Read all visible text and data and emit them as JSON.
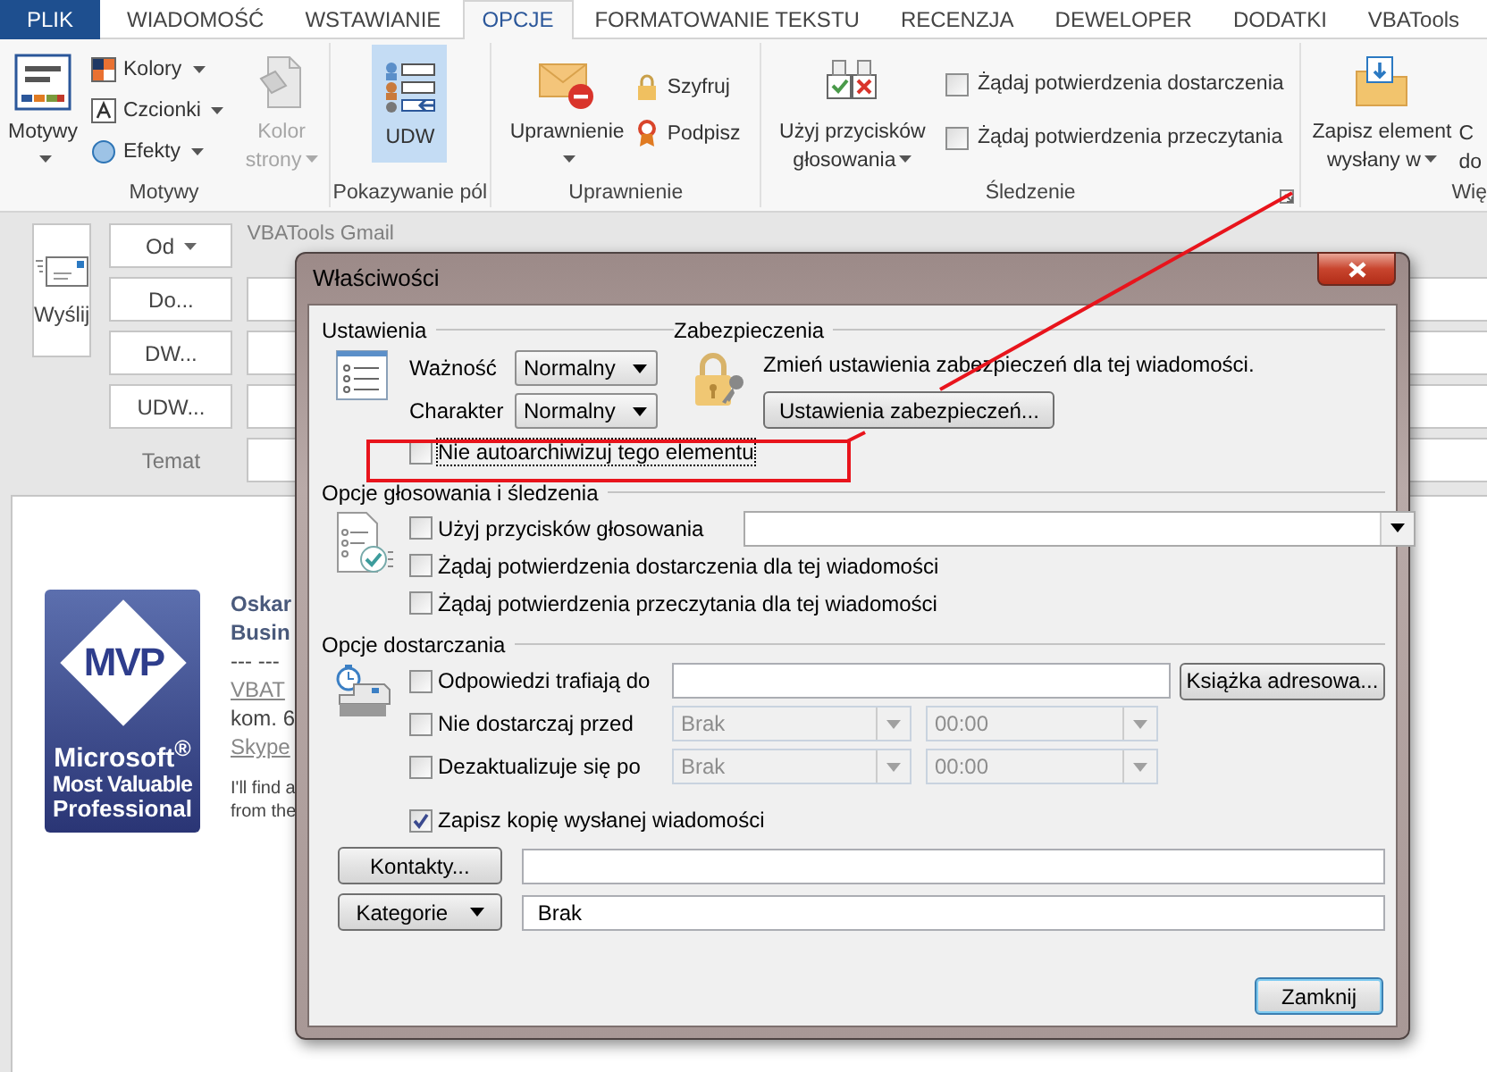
{
  "ribbon": {
    "tabs": [
      {
        "label": "PLIK",
        "kind": "file",
        "selected": false
      },
      {
        "label": "WIADOMOŚĆ",
        "kind": "tab",
        "selected": false
      },
      {
        "label": "WSTAWIANIE",
        "kind": "tab",
        "selected": false
      },
      {
        "label": "OPCJE",
        "kind": "tab",
        "selected": true
      },
      {
        "label": "FORMATOWANIE TEKSTU",
        "kind": "tab",
        "selected": false
      },
      {
        "label": "RECENZJA",
        "kind": "tab",
        "selected": false
      },
      {
        "label": "DEWELOPER",
        "kind": "tab",
        "selected": false
      },
      {
        "label": "DODATKI",
        "kind": "tab",
        "selected": false
      },
      {
        "label": "VBATools",
        "kind": "tab",
        "selected": false
      }
    ],
    "groups": [
      {
        "label": "Motywy",
        "items": [
          {
            "kind": "large",
            "label": "Motywy",
            "dropdown": true
          },
          {
            "kind": "stack",
            "items": [
              {
                "label": "Kolory",
                "dropdown": true
              },
              {
                "label": "Czcionki",
                "dropdown": true
              },
              {
                "label": "Efekty",
                "dropdown": true
              }
            ]
          },
          {
            "kind": "large",
            "label": "Kolor strony",
            "dropdown": true,
            "disabled": true
          }
        ]
      },
      {
        "label": "Pokazywanie pól",
        "items": [
          {
            "kind": "large",
            "label": "UDW",
            "selected": true
          }
        ]
      },
      {
        "label": "Uprawnienie",
        "items": [
          {
            "kind": "large",
            "label": "Uprawnienie",
            "dropdown": true
          },
          {
            "kind": "stack",
            "items": [
              {
                "label": "Szyfruj"
              },
              {
                "label": "Podpisz"
              }
            ]
          }
        ]
      },
      {
        "label": "Śledzenie",
        "launcher": true,
        "items": [
          {
            "kind": "large",
            "label": "Użyj przycisków głosowania",
            "dropdown": true
          },
          {
            "kind": "checks",
            "items": [
              {
                "label": "Żądaj potwierdzenia dostarczenia",
                "checked": false
              },
              {
                "label": "Żądaj potwierdzenia przeczytania",
                "checked": false
              }
            ]
          }
        ]
      },
      {
        "label": "Wię",
        "items": [
          {
            "kind": "large",
            "label": "Zapisz element wysłany w",
            "dropdown": true
          },
          {
            "kind": "cut",
            "lines": [
              "C",
              "do"
            ]
          }
        ]
      }
    ]
  },
  "compose": {
    "send_button": "Wyślij",
    "from_button": "Od",
    "account": "VBATools Gmail",
    "address_buttons": [
      "Do...",
      "DW...",
      "UDW..."
    ],
    "subject_label": "Temat"
  },
  "signature": {
    "logo_lines": [
      "MVP",
      "Microsoft$^{®}$",
      "Most Valuable",
      "Professional"
    ],
    "name": "Oskar",
    "title": "Busin",
    "separator": "--- ---",
    "lines": [
      {
        "text": "VBAT",
        "kind": "link"
      },
      {
        "text": "kom. 6",
        "kind": "plain"
      },
      {
        "text": "Skype",
        "kind": "link"
      }
    ],
    "note": [
      "I'll find a",
      "from the"
    ]
  },
  "dialog": {
    "title": "Właściwości",
    "settings": {
      "heading": "Ustawienia",
      "fields": [
        {
          "label": "Ważność",
          "value": "Normalny"
        },
        {
          "label": "Charakter",
          "value": "Normalny"
        }
      ],
      "no_autoarchive": {
        "label": "Nie autoarchiwizuj tego elementu",
        "checked": false,
        "focused": true
      }
    },
    "security": {
      "heading": "Zabezpieczenia",
      "text": "Zmień ustawienia zabezpieczeń dla tej wiadomości.",
      "button": "Ustawienia zabezpieczeń..."
    },
    "voting": {
      "heading": "Opcje głosowania i śledzenia",
      "options": [
        {
          "kind": "combo",
          "label": "Użyj przycisków głosowania",
          "checked": false
        },
        {
          "kind": "plain",
          "label": "Żądaj potwierdzenia dostarczenia dla tej wiadomości",
          "checked": false
        },
        {
          "kind": "plain",
          "label": "Żądaj potwierdzenia przeczytania dla tej wiadomości",
          "checked": false
        }
      ]
    },
    "delivery": {
      "heading": "Opcje dostarczania",
      "rows": [
        {
          "kind": "address",
          "label": "Odpowiedzi trafiają do",
          "checked": false,
          "button": "Książka adresowa..."
        },
        {
          "kind": "datetime",
          "label": "Nie dostarczaj przed",
          "checked": false,
          "date": "Brak",
          "time": "00:00",
          "disabled": true
        },
        {
          "kind": "datetime",
          "label": "Dezaktualizuje się po",
          "checked": false,
          "date": "Brak",
          "time": "00:00",
          "disabled": true
        },
        {
          "kind": "plain",
          "label": "Zapisz kopię wysłanej wiadomości",
          "checked": true
        }
      ]
    },
    "contacts_button": "Kontakty...",
    "categories_button": "Kategorie",
    "categories_value": "Brak",
    "close_button": "Zamknij"
  },
  "annotation": {
    "kind": "arrow-to-box"
  }
}
